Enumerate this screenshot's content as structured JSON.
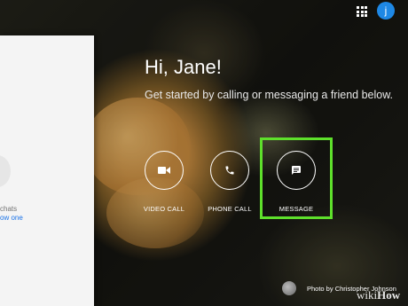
{
  "header": {
    "apps_icon": "apps-grid-icon",
    "avatar_letter": "j"
  },
  "sidebar": {
    "line1": "chats",
    "line2": "ow one"
  },
  "main": {
    "greeting": "Hi, Jane!",
    "subtitle": "Get started by calling or messaging a friend below."
  },
  "actions": [
    {
      "label": "VIDEO CALL",
      "icon": "video-camera-icon"
    },
    {
      "label": "PHONE CALL",
      "icon": "phone-icon"
    },
    {
      "label": "MESSAGE",
      "icon": "message-icon"
    }
  ],
  "highlight_color": "#5ee02b",
  "footer": {
    "credit": "Photo by Christopher Johnson",
    "watermark_part1": "wiki",
    "watermark_part2": "How"
  }
}
